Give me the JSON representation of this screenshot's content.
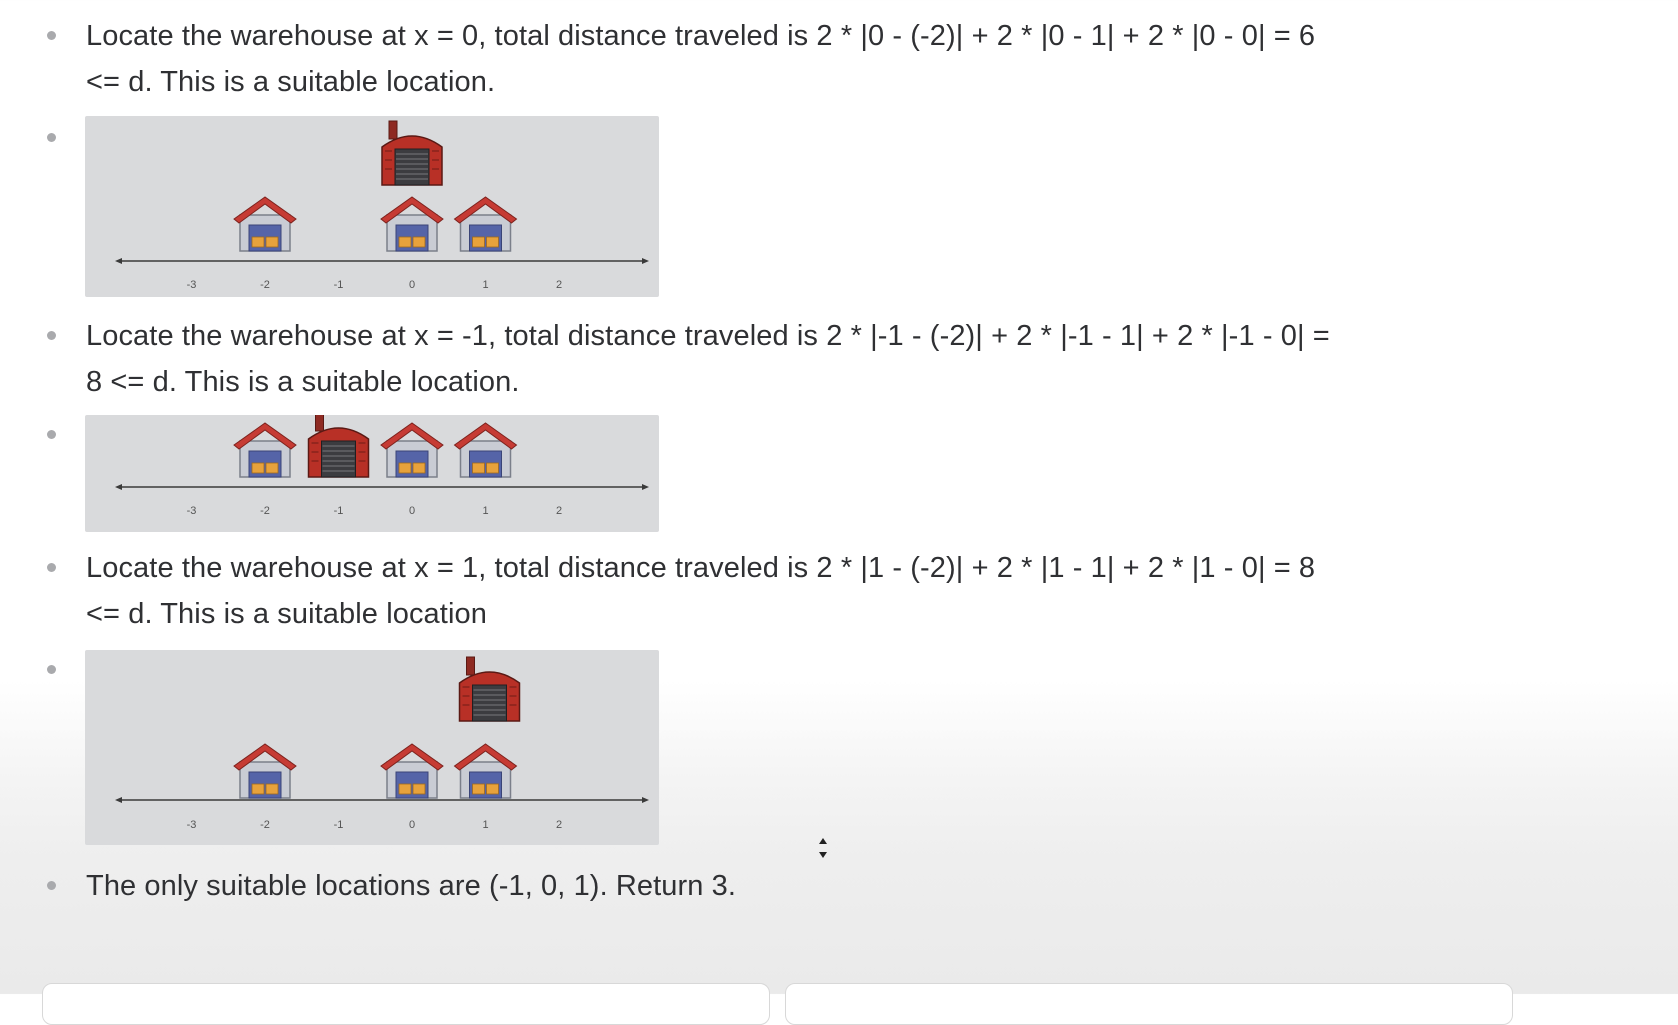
{
  "explanation": {
    "step_x0": {
      "line1": "Locate the warehouse at x = 0, total distance traveled is 2 * |0 - (-2)| + 2 * |0 - 1| + 2 * |0 - 0| = 6",
      "line2": "<= d. This is a suitable location."
    },
    "step_xm1": {
      "line1": "Locate the warehouse at x = -1, total distance traveled is 2 * |-1 - (-2)| + 2 * |-1 - 1| + 2 * |-1 - 0| =",
      "line2": "8 <= d. This is a suitable location."
    },
    "step_x1": {
      "line1": "Locate the warehouse at x = 1, total distance traveled is 2 * |1 - (-2)| + 2 * |1 - 1| + 2 * |1 - 0| = 8",
      "line2": "<= d. This is a suitable location"
    },
    "conclusion": "The only suitable locations are (-1, 0, 1). Return 3."
  },
  "figures": [
    {
      "ticks": [
        "-3",
        "-2",
        "-1",
        "0",
        "1",
        "2"
      ],
      "warehouse_at": 0,
      "stores_at": [
        -2,
        0,
        1
      ]
    },
    {
      "ticks": [
        "-3",
        "-2",
        "-1",
        "0",
        "1",
        "2"
      ],
      "warehouse_at": -1,
      "stores_at": [
        -2,
        0,
        1
      ]
    },
    {
      "ticks": [
        "-3",
        "-2",
        "-1",
        "0",
        "1",
        "2"
      ],
      "warehouse_at": 1,
      "stores_at": [
        -2,
        0,
        1
      ]
    }
  ],
  "icons": {
    "store": "store-icon",
    "warehouse": "warehouse-icon",
    "cursor": "resize-cursor-icon"
  },
  "colors": {
    "text": "#2f3033",
    "bullet": "#a9aaad",
    "figure_bg": "#d9dadc",
    "roof_red": "#c63b34",
    "wall_gray": "#c9ccd4",
    "door_blue": "#5564a8",
    "crate_orange": "#e7a23c",
    "warehouse_red": "#b83026"
  }
}
